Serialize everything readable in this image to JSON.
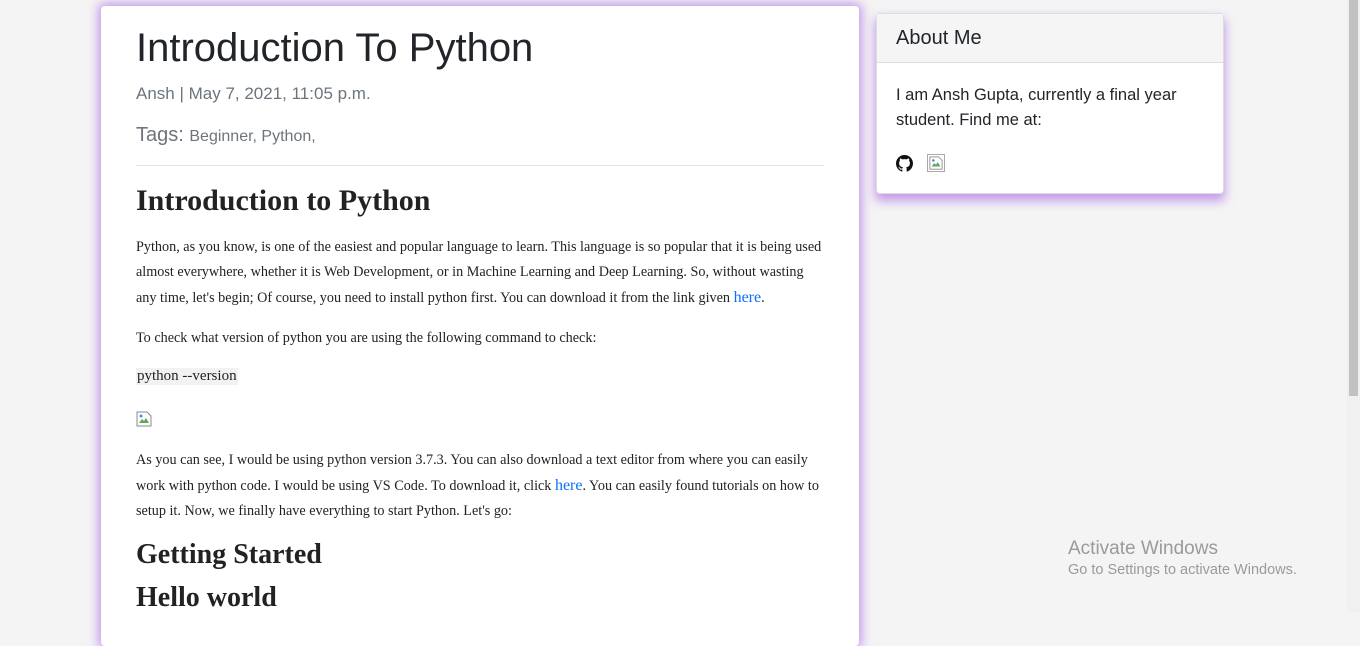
{
  "post": {
    "title": "Introduction To Python",
    "meta": "Ansh | May 7, 2021, 11:05 p.m.",
    "tags_label": "Tags:",
    "tags": "Beginner, Python,",
    "heading1": "Introduction to Python",
    "para1_text": "Python, as you know, is one of the easiest and popular language to learn. This language is so popular that it is being used almost everywhere, whether it is Web Development, or in Machine Learning and Deep Learning. So, without wasting any time, let's begin; Of course, you need to install python first. You can download it from the link given ",
    "para1_link": "here",
    "para1_end": ".",
    "para2": "To check what version of python you are using the following command to check:",
    "code": "python --version",
    "para3_text": "As you can see, I would be using python version 3.7.3. You can also download a text editor from where you can easily work with python code. I would be using VS Code. To download it, click ",
    "para3_link": "here",
    "para3_end": ". You  can easily found tutorials on how to setup it. Now, we finally have everything to start Python. Let's go:",
    "heading2": "Getting Started",
    "heading3": "Hello world"
  },
  "about": {
    "title": "About Me",
    "body": "I am Ansh Gupta, currently a final year student. Find me at:",
    "icons": [
      "github-icon",
      "broken-image-icon"
    ]
  },
  "watermark": {
    "title": "Activate Windows",
    "subtitle": "Go to Settings to activate Windows."
  }
}
